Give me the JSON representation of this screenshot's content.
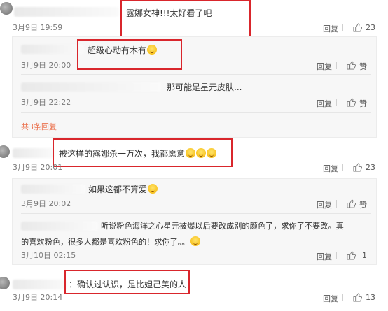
{
  "comments": [
    {
      "text": "露娜女神!!!太好看了吧",
      "time": "3月9日 19:59",
      "reply_label": "回复",
      "like_count": "23",
      "replies": [
        {
          "text": "超级心动有木有",
          "time": "3月9日 20:00",
          "reply_label": "回复",
          "like_label": "赞"
        },
        {
          "text": "那可能是星元皮肤...",
          "time": "3月9日 22:22",
          "reply_label": "回复",
          "like_label": "赞"
        }
      ],
      "expand_label": "共3条回复"
    },
    {
      "text": "被这样的露娜杀一万次，我都愿意",
      "time": "3月9日 20:01",
      "reply_label": "回复",
      "like_count": "23",
      "replies": [
        {
          "text": "如果这都不算爱",
          "time": "3月9日 20:02",
          "reply_label": "回复",
          "like_label": "赞"
        },
        {
          "text_line1": "听说粉色海洋之心星元被爆以后要改成别的颜色了，求你了不要改。真",
          "text_line2": "的喜欢粉色，很多人都是喜欢粉色的！求你了。。",
          "time": "3月10日 02:15",
          "reply_label": "回复",
          "like_count": "1"
        }
      ]
    },
    {
      "text": "：确认过认识，是比妲己美的人",
      "time": "3月9日 20:14",
      "reply_label": "回复",
      "like_count": "13"
    }
  ],
  "colors": {
    "highlight": "#d9262c",
    "link": "#eb7350"
  }
}
